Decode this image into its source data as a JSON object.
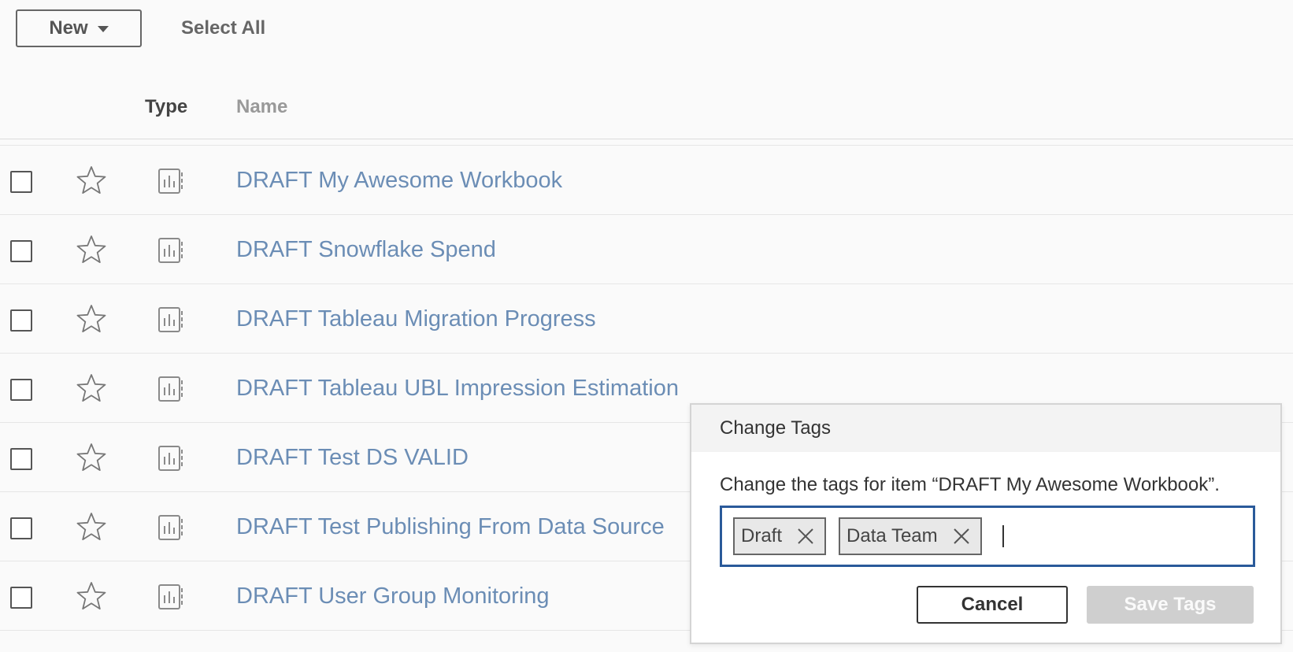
{
  "toolbar": {
    "new_label": "New",
    "select_all_label": "Select All"
  },
  "columns": {
    "type": "Type",
    "name": "Name"
  },
  "rows": [
    {
      "name": "DRAFT My Awesome Workbook",
      "type_icon": "workbook-icon"
    },
    {
      "name": "DRAFT Snowflake Spend",
      "type_icon": "workbook-icon"
    },
    {
      "name": "DRAFT Tableau Migration Progress",
      "type_icon": "workbook-icon"
    },
    {
      "name": "DRAFT Tableau UBL Impression Estimation",
      "type_icon": "workbook-icon"
    },
    {
      "name": "DRAFT Test DS VALID",
      "type_icon": "workbook-icon"
    },
    {
      "name": "DRAFT Test Publishing From Data Source",
      "type_icon": "workbook-icon"
    },
    {
      "name": "DRAFT User Group Monitoring",
      "type_icon": "workbook-icon"
    }
  ],
  "dialog": {
    "title": "Change Tags",
    "description": "Change the tags for item “DRAFT My Awesome Workbook”.",
    "tags": [
      "Draft",
      "Data Team"
    ],
    "input_value": "",
    "cancel_label": "Cancel",
    "save_label": "Save Tags"
  },
  "colors": {
    "link": "#6b8db5",
    "focus_border": "#2a5a9a",
    "disabled_button": "#cfcfcf"
  }
}
